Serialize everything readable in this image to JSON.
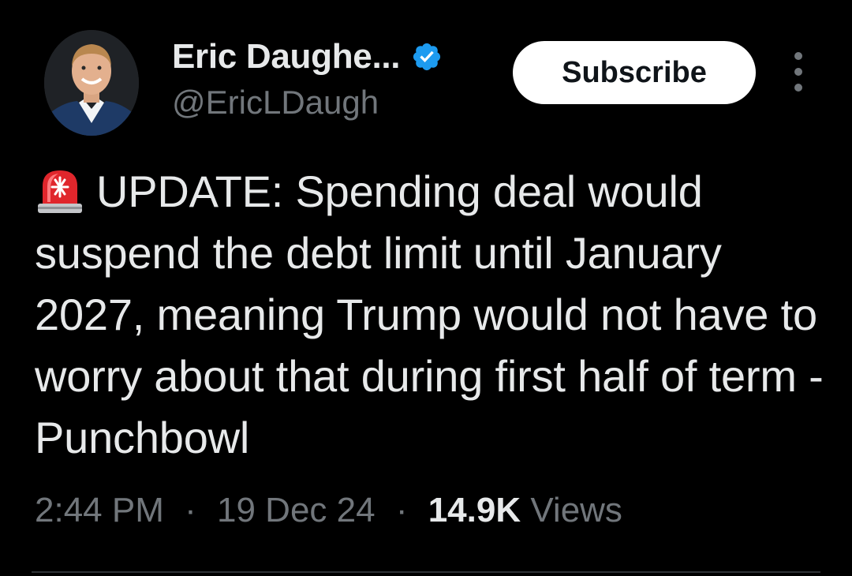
{
  "author": {
    "display_name": "Eric Daughe...",
    "handle": "@EricLDaugh",
    "verified": true
  },
  "actions": {
    "subscribe_label": "Subscribe",
    "more_icon": "more-vertical-icon"
  },
  "tweet": {
    "emoji_icon": "police-siren-icon",
    "text": "UPDATE: Spending deal would suspend the debt limit until January 2027, meaning Trump would not have to worry about that during first half of term - Punchbowl"
  },
  "meta": {
    "time": "2:44 PM",
    "date": "19 Dec 24",
    "separator": "·",
    "views_count": "14.9K",
    "views_label": "Views"
  },
  "colors": {
    "background": "#000000",
    "primary_text": "#e7e9ea",
    "secondary_text": "#71767b",
    "verified_blue": "#1d9bf0",
    "button_bg": "#ffffff",
    "button_text": "#0f1419"
  }
}
